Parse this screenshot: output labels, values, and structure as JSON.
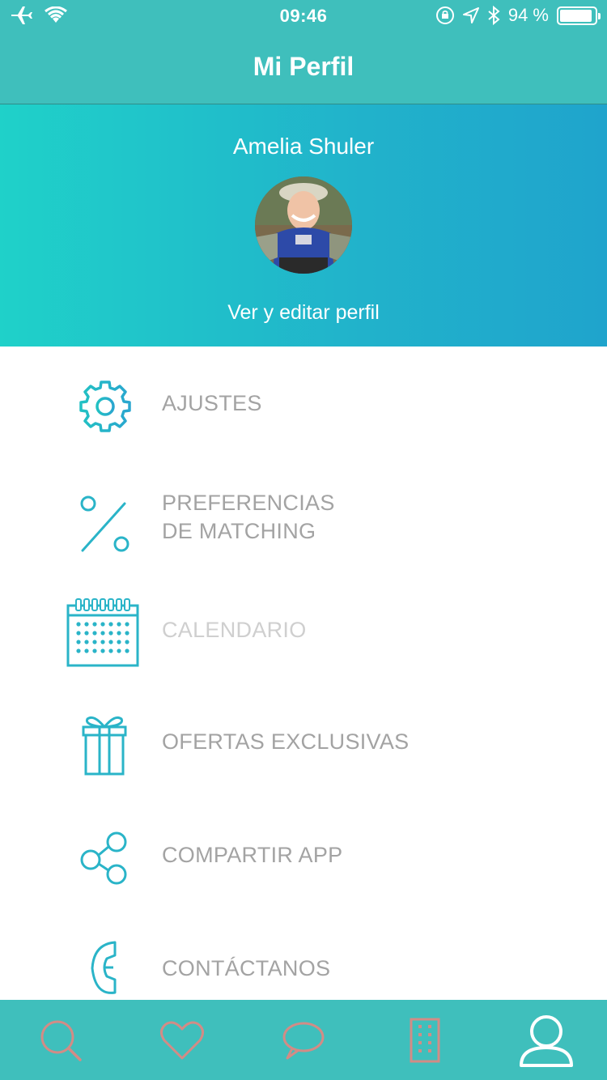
{
  "status_bar": {
    "time": "09:46",
    "battery_percent_label": "94 %",
    "battery_level": 0.94
  },
  "header": {
    "title": "Mi Perfil"
  },
  "profile": {
    "name": "Amelia Shuler",
    "edit_link": "Ver y editar perfil"
  },
  "menu": {
    "items": [
      {
        "icon": "gear-icon",
        "label": "AJUSTES"
      },
      {
        "icon": "percent-icon",
        "label_line1": "PREFERENCIAS",
        "label_line2": "DE MATCHING"
      },
      {
        "icon": "calendar-icon",
        "label": "CALENDARIO"
      },
      {
        "icon": "gift-icon",
        "label": "OFERTAS EXCLUSIVAS"
      },
      {
        "icon": "share-icon",
        "label": "COMPARTIR APP"
      },
      {
        "icon": "phone-icon",
        "label": "CONTÁCTANOS"
      }
    ]
  },
  "tab_bar": {
    "tabs": [
      {
        "icon": "search-icon"
      },
      {
        "icon": "heart-icon"
      },
      {
        "icon": "chat-icon"
      },
      {
        "icon": "building-icon"
      },
      {
        "icon": "profile-icon",
        "active": true
      }
    ]
  },
  "colors": {
    "accent": "#3fbfbc",
    "icon_teal": "#2bb4c6",
    "menu_text": "#a3a3a3",
    "inactive_tab_icon": "#d28c86"
  }
}
